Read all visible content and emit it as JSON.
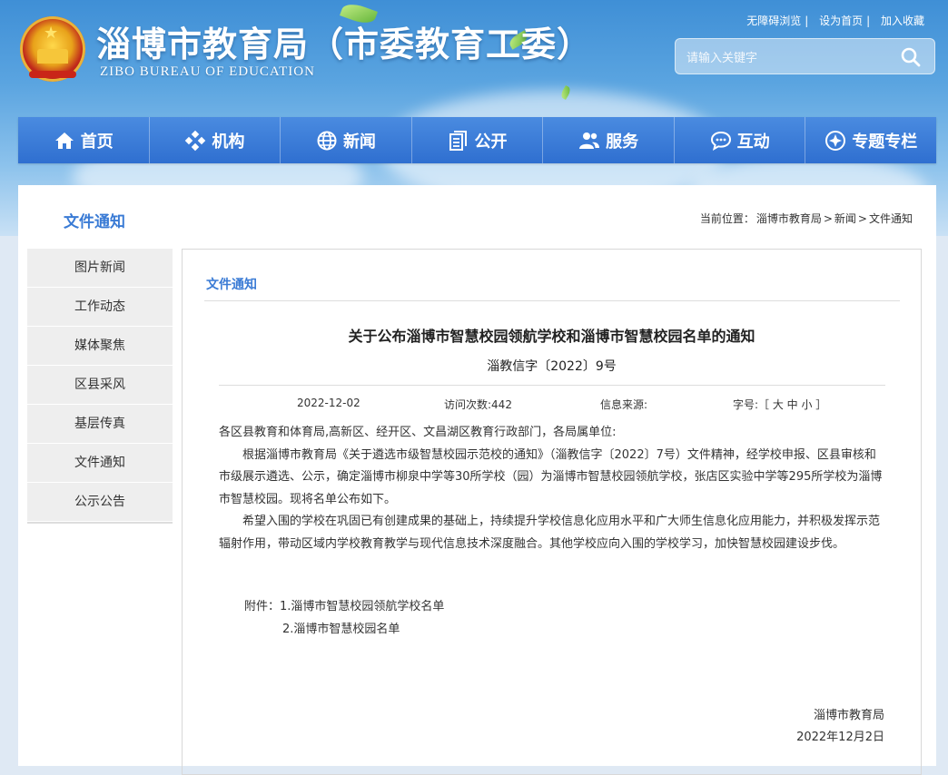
{
  "header": {
    "title": "淄博市教育局（市委教育工委）",
    "subtitle": "ZIBO BUREAU OF EDUCATION",
    "links": [
      "无障碍浏览",
      "设为首页",
      "加入收藏"
    ],
    "search_placeholder": "请输入关键字"
  },
  "nav": {
    "items": [
      {
        "label": "首页",
        "icon": "home-icon"
      },
      {
        "label": "机构",
        "icon": "org-icon"
      },
      {
        "label": "新闻",
        "icon": "globe-icon"
      },
      {
        "label": "公开",
        "icon": "document-icon"
      },
      {
        "label": "服务",
        "icon": "users-icon"
      },
      {
        "label": "互动",
        "icon": "chat-icon"
      },
      {
        "label": "专题专栏",
        "icon": "plus-circle-icon"
      }
    ]
  },
  "section": {
    "title": "文件通知",
    "breadcrumb_prefix": "当前位置：",
    "breadcrumb": [
      "淄博市教育局",
      "新闻",
      "文件通知"
    ]
  },
  "sidebar": {
    "items": [
      "图片新闻",
      "工作动态",
      "媒体聚焦",
      "区县采风",
      "基层传真",
      "文件通知",
      "公示公告"
    ]
  },
  "article": {
    "category": "文件通知",
    "title": "关于公布淄博市智慧校园领航学校和淄博市智慧校园名单的通知",
    "doc_number": "淄教信字〔2022〕9号",
    "date": "2022-12-02",
    "visits": "访问次数:442",
    "source": "信息来源:",
    "font_size_label": "字号:［ 大 中 小 ］",
    "salutation": "各区县教育和体育局,高新区、经开区、文昌湖区教育行政部门，各局属单位:",
    "paragraph1": "根据淄博市教育局《关于遴选市级智慧校园示范校的通知》（淄教信字〔2022〕7号）文件精神，经学校申报、区县审核和市级展示遴选、公示，确定淄博市柳泉中学等30所学校（园）为淄博市智慧校园领航学校，张店区实验中学等295所学校为淄博市智慧校园。现将名单公布如下。",
    "paragraph2": "希望入围的学校在巩固已有创建成果的基础上，持续提升学校信息化应用水平和广大师生信息化应用能力，并积极发挥示范辐射作用，带动区域内学校教育教学与现代信息技术深度融合。其他学校应向入围的学校学习，加快智慧校园建设步伐。",
    "attachment1": "附件：1.淄博市智慧校园领航学校名单",
    "attachment2": "2.淄博市智慧校园名单",
    "signature_org": "淄博市教育局",
    "signature_date": "2022年12月2日"
  }
}
